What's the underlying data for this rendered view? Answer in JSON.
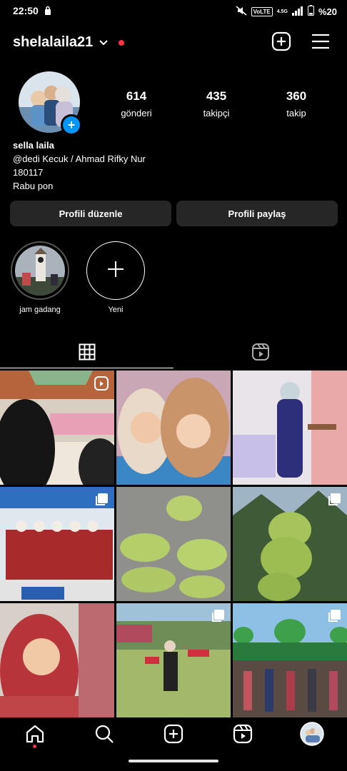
{
  "status": {
    "time": "22:50",
    "volte": "VoLTE",
    "net": "4.5G",
    "battery": "%20"
  },
  "header": {
    "username": "shelalaila21",
    "dot_color": "#ff3040"
  },
  "stats": [
    {
      "num": "614",
      "label": "gönderi"
    },
    {
      "num": "435",
      "label": "takipçi"
    },
    {
      "num": "360",
      "label": "takip"
    }
  ],
  "bio": {
    "name": "sella laila",
    "line1": "@dedi Kecuk / Ahmad Rifky Nur",
    "line2": "180117",
    "line3": "Rabu pon"
  },
  "buttons": {
    "edit": "Profili düzenle",
    "share": "Profili paylaş"
  },
  "highlights": [
    {
      "label": "jam gadang"
    },
    {
      "label": "Yeni"
    }
  ],
  "tabs": {
    "grid": "grid-icon",
    "reels": "reels-icon"
  },
  "nav": [
    "home-icon",
    "search-icon",
    "create-icon",
    "reels-icon",
    "profile-avatar"
  ],
  "colors": {
    "accent": "#0095f6",
    "button_bg": "#262626",
    "notification": "#ff3040"
  }
}
